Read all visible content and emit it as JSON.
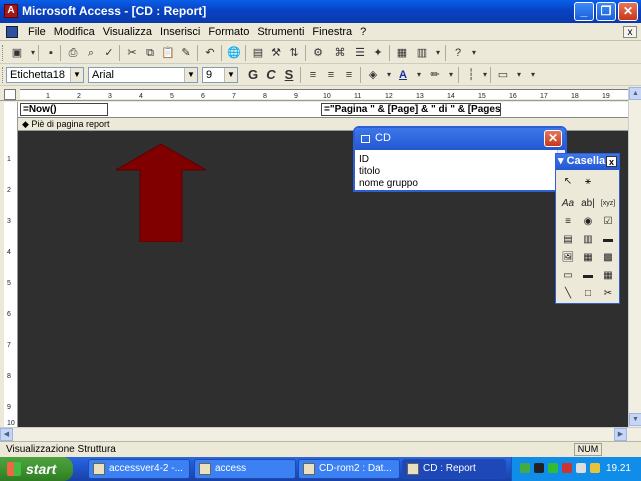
{
  "window": {
    "title": "Microsoft Access - [CD : Report]",
    "min_glyph": "_",
    "max_glyph": "❐",
    "close_glyph": "✕"
  },
  "menu": {
    "items": [
      "File",
      "Modifica",
      "Visualizza",
      "Inserisci",
      "Formato",
      "Strumenti",
      "Finestra",
      "?"
    ],
    "close_glyph": "x"
  },
  "formatting": {
    "control_name": "Etichetta18",
    "font_name": "Arial",
    "font_size": "9",
    "bold_label": "G",
    "italic_label": "C",
    "underline_label": "S"
  },
  "ruler": {
    "ticks": [
      "1",
      "2",
      "3",
      "4",
      "5",
      "6",
      "7",
      "8",
      "9",
      "10",
      "11",
      "12",
      "13",
      "14",
      "15",
      "16",
      "17",
      "18",
      "19"
    ]
  },
  "vruler": {
    "ticks": [
      "1",
      "2",
      "3",
      "4",
      "5",
      "6",
      "7",
      "8",
      "9",
      "10"
    ]
  },
  "report": {
    "field_now": "=Now()",
    "field_pages": "=\"Pagina \" & [Page] & \" di \" & [Pages]",
    "footer_section": "◆ Piè di pagina report"
  },
  "field_list": {
    "title": "CD",
    "items": [
      "ID",
      "titolo",
      "nome gruppo"
    ],
    "close_glyph": "✕"
  },
  "toolbox": {
    "title": "Casella",
    "close_glyph": "x",
    "tools": [
      "↖",
      "⚹",
      "Aa",
      "ab|",
      "[xyz]",
      "≡",
      "◉",
      "☑",
      "▤",
      "▥",
      "▬",
      "🖼",
      "▦",
      "▩",
      "▭",
      "▬",
      "▦",
      "╲",
      "□",
      "✂"
    ]
  },
  "status": {
    "text": "Visualizzazione Struttura",
    "num": "NUM"
  },
  "taskbar": {
    "start_label": "start",
    "tasks": [
      "accessver4-2 -...",
      "access",
      "CD-rom2 : Dat...",
      "CD : Report"
    ],
    "clock": "19.21"
  },
  "colors": {
    "arrow": "#800000",
    "design_background": "#2f2f2f",
    "title_blue": "#0a4fd8"
  }
}
